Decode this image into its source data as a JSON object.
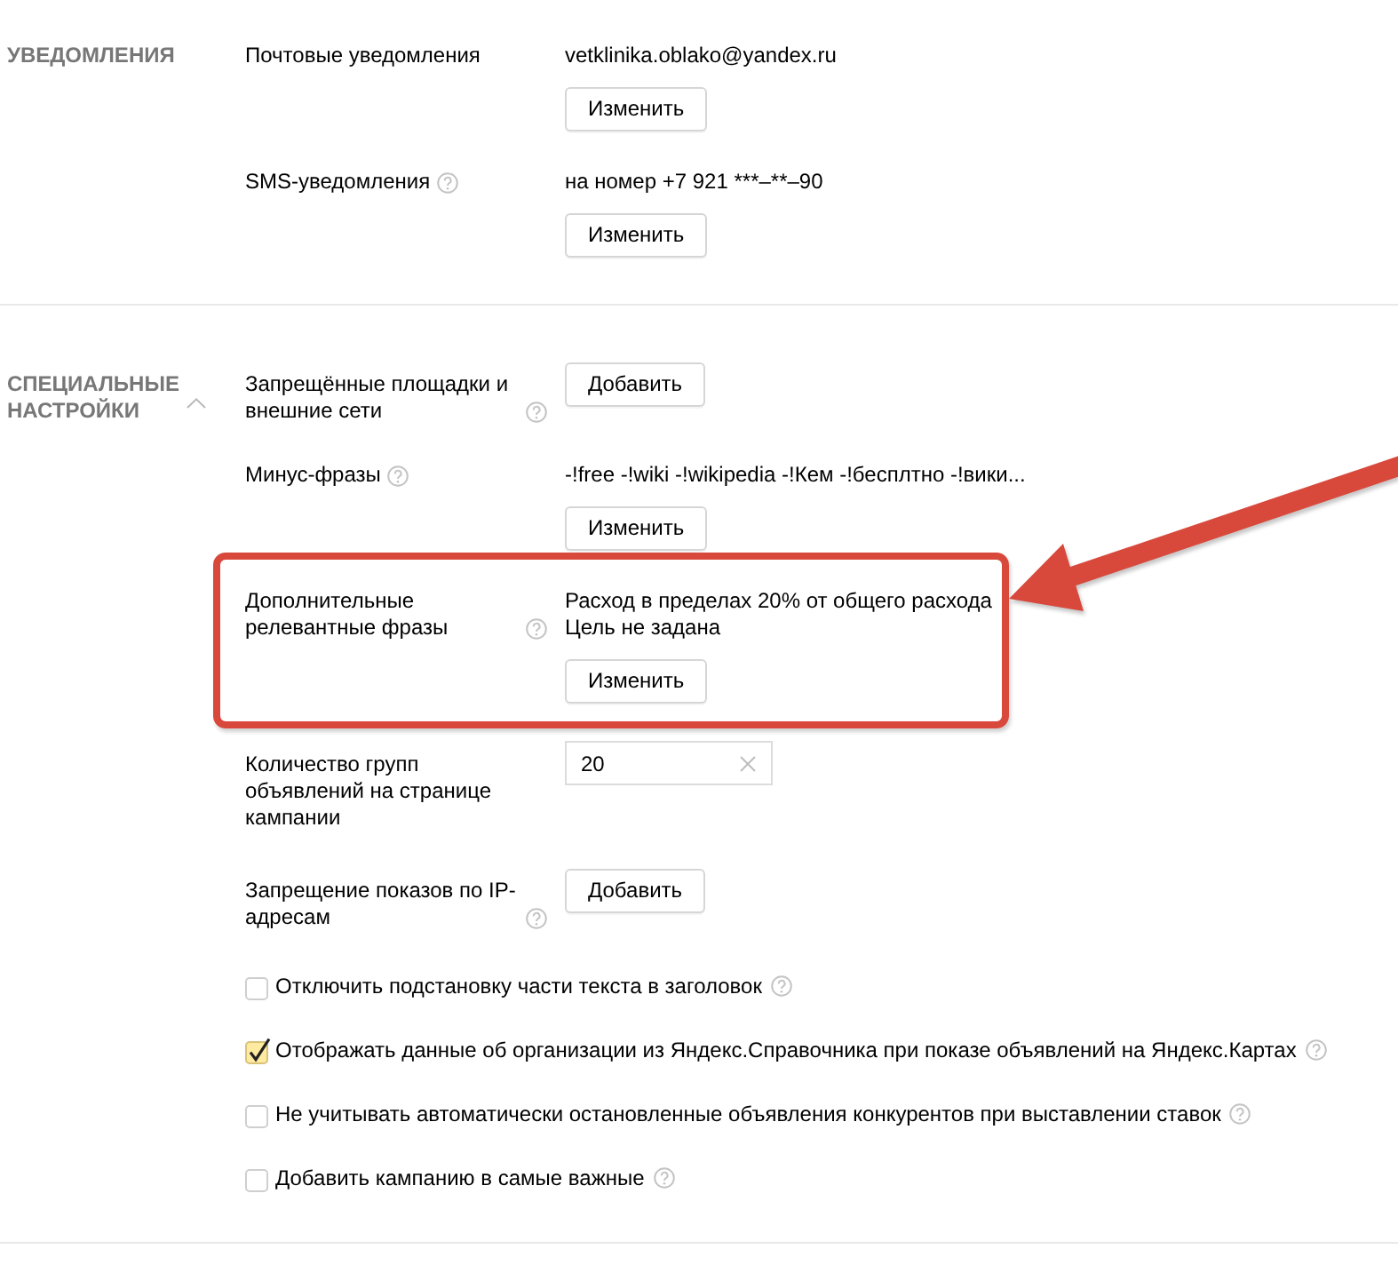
{
  "sections": [
    {
      "title": "УВЕДОМЛЕНИЯ",
      "rows": [
        {
          "kind": "button",
          "label": "Почтовые уведомления",
          "help": false,
          "highlighted": false,
          "values": [
            "vetklinika.oblako@yandex.ru"
          ],
          "button": "Изменить"
        },
        {
          "kind": "button",
          "label": "SMS-уведомления",
          "help": true,
          "highlighted": false,
          "values": [
            "на номер +7 921 ***–**–90"
          ],
          "button": "Изменить"
        }
      ]
    },
    {
      "title": "СПЕЦИАЛЬНЫЕ НАСТРОЙКИ",
      "expanded": true,
      "rows": [
        {
          "kind": "button",
          "label": "Запрещённые площадки и внешние сети",
          "help": true,
          "highlighted": false,
          "button": "Добавить"
        },
        {
          "kind": "button",
          "label": "Минус-фразы",
          "help": true,
          "highlighted": false,
          "values": [
            "-!free -!wiki -!wikipedia -!Кем -!бесплтно -!вики..."
          ],
          "button": "Изменить"
        },
        {
          "kind": "button",
          "label": "Дополнительные релевантные фразы",
          "help": true,
          "highlighted": true,
          "values": [
            "Расход в пределах 20% от общего расхода",
            "Цель не задана"
          ],
          "button": "Изменить"
        },
        {
          "kind": "input",
          "label": "Количество групп объявлений на странице кампании",
          "help": false,
          "highlighted": false,
          "input": {
            "value": "20"
          }
        },
        {
          "kind": "button",
          "label": "Запрещение показов по IP-адресам",
          "help": true,
          "highlighted": false,
          "button": "Добавить"
        }
      ],
      "options": [
        {
          "label": "Отключить подстановку части текста в заголовок",
          "checked": false,
          "help": true
        },
        {
          "label": "Отображать данные об организации из Яндекс.Справочника при показе объявлений на Яндекс.Картах",
          "checked": true,
          "help": true
        },
        {
          "label": "Не учитывать автоматически остановленные объявления конкурентов при выставлении ставок",
          "checked": false,
          "help": true
        },
        {
          "label": "Добавить кампанию в самые важные",
          "checked": false,
          "help": true
        }
      ]
    }
  ]
}
